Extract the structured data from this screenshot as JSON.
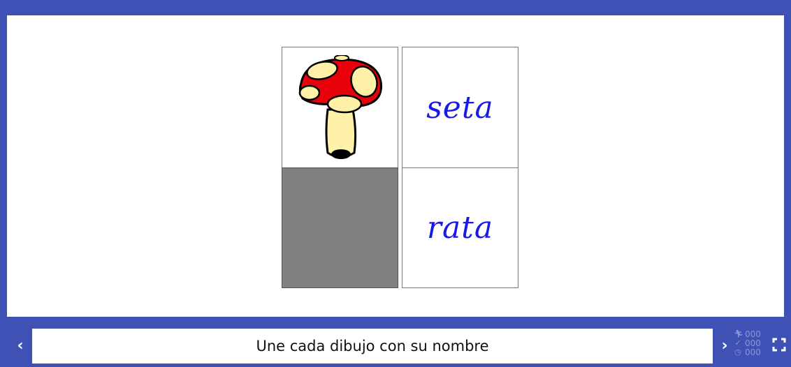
{
  "board": {
    "cards": [
      {
        "id": "mushroom",
        "kind": "image",
        "icon": "mushroom-picture"
      },
      {
        "id": "seta",
        "kind": "word",
        "text": "seta"
      },
      {
        "id": "empty",
        "kind": "empty"
      },
      {
        "id": "rata",
        "kind": "word",
        "text": "rata"
      }
    ]
  },
  "footer": {
    "prev_label": "‹",
    "next_label": "›",
    "message": "Une cada dibujo con su nombre",
    "counters": {
      "actions": "000",
      "correct": "000",
      "time": "000"
    }
  },
  "colors": {
    "frame": "#3f51b5",
    "word": "#1a1ae6",
    "empty_cell": "#808080",
    "mushroom_cap": "#e8000a",
    "mushroom_spots": "#fff1a8"
  }
}
